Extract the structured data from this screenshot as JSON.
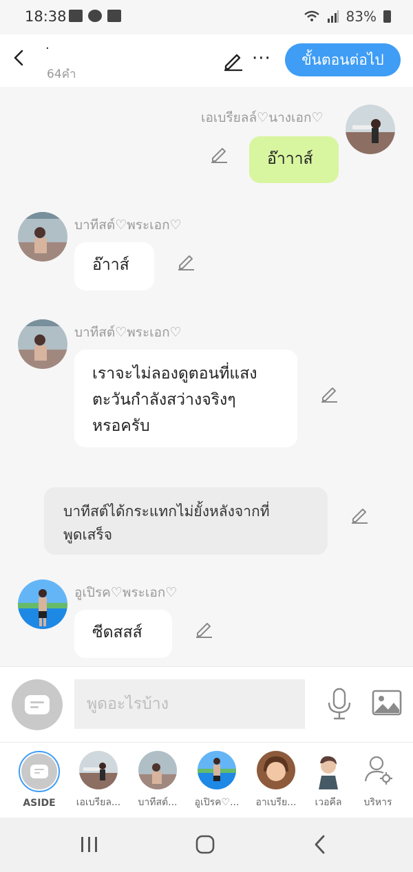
{
  "status_bar": {
    "time": "18:38",
    "battery": "83%"
  },
  "header": {
    "title_dot": "·",
    "word_count": "64คำ",
    "next_button": "ขั้นตอนต่อไป"
  },
  "messages": [
    {
      "speaker": "เอเบรียลล์♡นางเอก♡",
      "text": "อ๊าาาส์",
      "side": "right"
    },
    {
      "speaker": "บาทีสต์♡พระเอก♡",
      "text": "อ๊าาส์",
      "side": "left"
    },
    {
      "speaker": "บาทีสต์♡พระเอก♡",
      "lines": [
        "เราจะไม่ลองดูตอนที่แสง",
        "ตะวันกำลังสว่างจริงๆ",
        "หรอครับ"
      ],
      "side": "left"
    },
    {
      "narration": [
        "บาทีสต์ได้กระแทกไม่ยั้งหลังจากที่",
        "พูดเสร็จ"
      ]
    },
    {
      "speaker": "อูเปิรค♡พระเอก♡",
      "text": "ซีดสสส์",
      "side": "left"
    }
  ],
  "composer": {
    "placeholder": "พูดอะไรบ้าง"
  },
  "characters": [
    {
      "label": "ASIDE"
    },
    {
      "label": "เอเบรียล..."
    },
    {
      "label": "บาทีสต์..."
    },
    {
      "label": "อูเปิรค♡..."
    },
    {
      "label": "อาเบรีย..."
    },
    {
      "label": "เวอคีล"
    },
    {
      "label": "บริหาร"
    }
  ],
  "colors": {
    "accent": "#3f9df5",
    "my_bubble": "#d8f5a0",
    "background": "#f6f6f6"
  }
}
